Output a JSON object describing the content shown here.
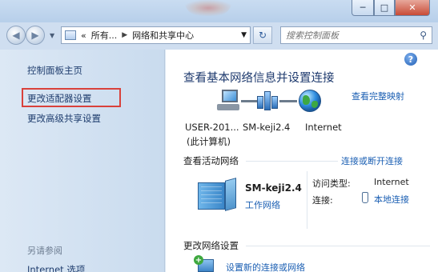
{
  "window": {
    "min_label": "─",
    "max_label": "□",
    "close_label": "✕"
  },
  "nav": {
    "back_glyph": "◀",
    "forward_glyph": "▶",
    "recent_glyph": "▼",
    "address": {
      "crumb_prefix": "«",
      "crumb_1": "所有...",
      "sep": "▶",
      "crumb_2": "网络和共享中心",
      "dropdown": "▼"
    },
    "refresh_glyph": "↻",
    "search": {
      "placeholder": "搜索控制面板",
      "icon": "search-icon",
      "icon_glyph": "⚲"
    }
  },
  "sidebar": {
    "items": [
      {
        "label": "控制面板主页"
      },
      {
        "label": "更改适配器设置"
      },
      {
        "label": "更改高级共享设置"
      }
    ],
    "see_also": "另请参阅",
    "see_also_items": [
      {
        "label": "Internet 选项"
      }
    ]
  },
  "main": {
    "help_glyph": "?",
    "title": "查看基本网络信息并设置连接",
    "view_full_map": "查看完整映射",
    "map": {
      "computer_name": "USER-201...",
      "computer_sub": "(此计算机)",
      "network_name": "SM-keji2.4",
      "internet": "Internet"
    },
    "active_networks": {
      "heading": "查看活动网络",
      "connect_link": "连接或断开连接",
      "network_name": "SM-keji2.4",
      "network_type": "工作网络",
      "access_type_label": "访问类型:",
      "access_type_value": "Internet",
      "connections_label": "连接:",
      "connections_value": "本地连接"
    },
    "change_settings": {
      "heading": "更改网络设置",
      "setup_link": "设置新的连接或网络"
    }
  },
  "colors": {
    "link": "#1b5fb3",
    "highlight_box": "#d9413b",
    "sidebar_bg": "#d4e3f3"
  }
}
